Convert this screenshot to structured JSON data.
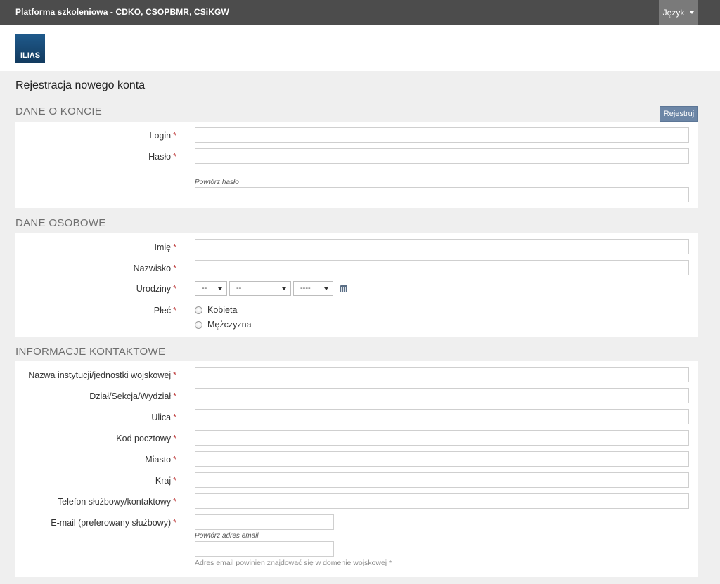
{
  "topbar": {
    "title": "Platforma szkoleniowa - CDKO, CSOPBMR, CSiKGW",
    "language_label": "Język"
  },
  "logo": {
    "text": "ILIAS"
  },
  "page_title": "Rejestracja nowego konta",
  "register_button": "Rejestruj",
  "required_marker": "*",
  "sections": {
    "account": {
      "title": "DANE O KONCIE",
      "login_label": "Login",
      "password_label": "Hasło",
      "repeat_password_hint": "Powtórz hasło"
    },
    "personal": {
      "title": "DANE OSOBOWE",
      "first_name_label": "Imię",
      "last_name_label": "Nazwisko",
      "birthday_label": "Urodziny",
      "birthday_day": "--",
      "birthday_month": "--",
      "birthday_year": "----",
      "gender_label": "Płeć",
      "gender_female": "Kobieta",
      "gender_male": "Mężczyzna"
    },
    "contact": {
      "title": "INFORMACJE KONTAKTOWE",
      "institution_label": "Nazwa instytucji/jednostki wojskowej",
      "department_label": "Dział/Sekcja/Wydział",
      "street_label": "Ulica",
      "zip_label": "Kod pocztowy",
      "city_label": "Miasto",
      "country_label": "Kraj",
      "phone_label": "Telefon służbowy/kontaktowy",
      "email_label": "E-mail (preferowany służbowy)",
      "repeat_email_hint": "Powtórz adres email",
      "email_note": "Adres email powinien znajdować się w domenie wojskowej *"
    }
  }
}
